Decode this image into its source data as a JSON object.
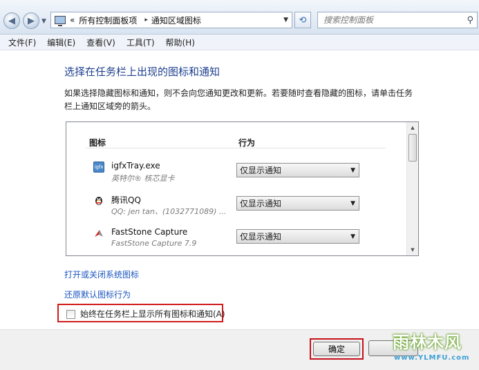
{
  "address": {
    "back_symbol": "◀",
    "forward_symbol": "▶",
    "prefix": "«",
    "crumbs": [
      "所有控制面板项",
      "通知区域图标"
    ],
    "sep": "▸"
  },
  "search": {
    "placeholder": "搜索控制面板"
  },
  "menu": [
    "文件(F)",
    "编辑(E)",
    "查看(V)",
    "工具(T)",
    "帮助(H)"
  ],
  "heading": "选择在任务栏上出现的图标和通知",
  "description": "如果选择隐藏图标和通知，则不会向您通知更改和更新。若要随时查看隐藏的图标，请单击任务栏上通知区域旁的箭头。",
  "table": {
    "col_icon": "图标",
    "col_behavior": "行为",
    "rows": [
      {
        "name": "igfxTray.exe",
        "sub": "英特尔® 核芯显卡",
        "behavior": "仅显示通知",
        "icon": "intel-graphics-icon"
      },
      {
        "name": "腾讯QQ",
        "sub": "QQ: jen tan、(1032771089) ...",
        "behavior": "仅显示通知",
        "icon": "qq-penguin-icon"
      },
      {
        "name": "FastStone Capture",
        "sub": "FastStone Capture 7.9",
        "behavior": "仅显示通知",
        "icon": "faststone-capture-icon"
      }
    ]
  },
  "links": {
    "system_icons": "打开或关闭系统图标",
    "restore": "还原默认图标行为"
  },
  "checkbox": {
    "label": "始终在任务栏上显示所有图标和通知(A)",
    "checked": false
  },
  "buttons": {
    "ok": "确定"
  },
  "watermark": {
    "text": "雨林木风",
    "url": "www.YLMFU.com"
  },
  "colors": {
    "heading": "#1d3f8f",
    "link": "#1a55c0",
    "highlight": "#d11a1a"
  }
}
